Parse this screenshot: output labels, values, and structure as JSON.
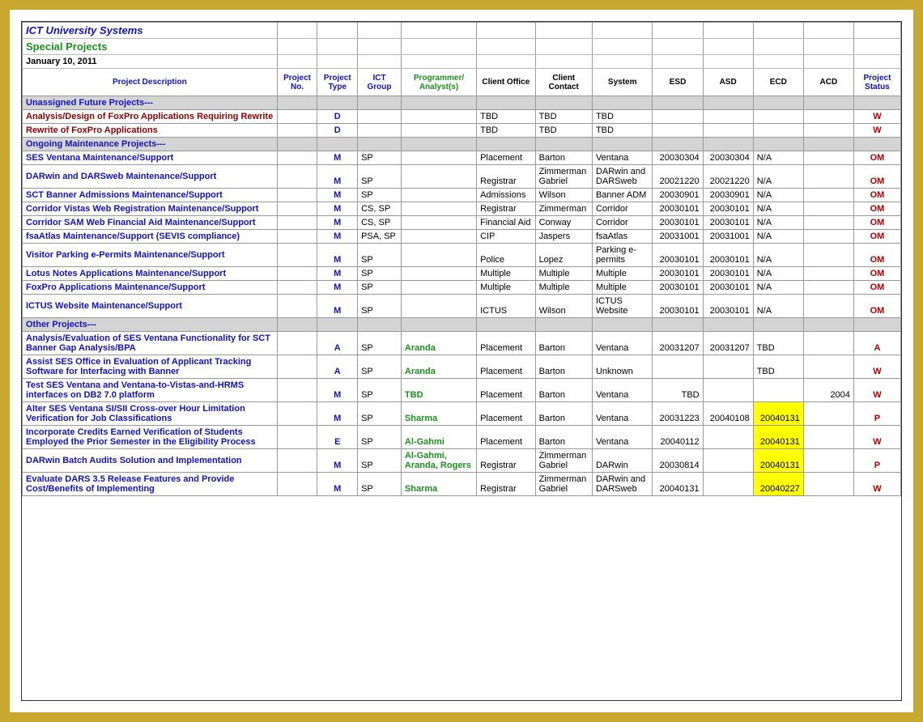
{
  "header": {
    "org": "ICT University Systems",
    "title": "Special Projects",
    "date": "January 10, 2011"
  },
  "columns": {
    "desc": "Project Description",
    "no": "Project No.",
    "type": "Project Type",
    "group": "ICT Group",
    "prog": "Programmer/ Analyst(s)",
    "office": "Client Office",
    "contact": "Client Contact",
    "system": "System",
    "esd": "ESD",
    "asd": "ASD",
    "ecd": "ECD",
    "acd": "ACD",
    "status": "Project Status"
  },
  "sections": [
    {
      "label": "Unassigned Future Projects---",
      "rows": [
        {
          "desc": "Analysis/Design of FoxPro Applications Requiring Rewrite",
          "descStyle": "darkred",
          "type": "D",
          "group": "",
          "prog": "",
          "office": "TBD",
          "contact": "TBD",
          "system": "TBD",
          "esd": "",
          "asd": "",
          "ecd": "",
          "ecdHL": false,
          "acd": "",
          "status": "W"
        },
        {
          "desc": "Rewrite of FoxPro Applications",
          "descStyle": "darkred",
          "type": "D",
          "group": "",
          "prog": "",
          "office": "TBD",
          "contact": "TBD",
          "system": "TBD",
          "esd": "",
          "asd": "",
          "ecd": "",
          "ecdHL": false,
          "acd": "",
          "status": "W"
        }
      ]
    },
    {
      "label": "Ongoing Maintenance Projects---",
      "rows": [
        {
          "desc": "SES Ventana Maintenance/Support",
          "descStyle": "",
          "type": "M",
          "group": "SP",
          "prog": "",
          "office": "Placement",
          "contact": "Barton",
          "system": "Ventana",
          "esd": "20030304",
          "asd": "20030304",
          "ecd": "N/A",
          "ecdHL": false,
          "acd": "",
          "status": "OM"
        },
        {
          "desc": "DARwin and DARSweb Maintenance/Support",
          "descStyle": "",
          "type": "M",
          "group": "SP",
          "prog": "",
          "office": "Registrar",
          "contact": "Zimmerman Gabriel",
          "system": "DARwin and DARSweb",
          "esd": "20021220",
          "asd": "20021220",
          "ecd": "N/A",
          "ecdHL": false,
          "acd": "",
          "status": "OM"
        },
        {
          "desc": "SCT Banner Admissions Maintenance/Support",
          "descStyle": "",
          "type": "M",
          "group": "SP",
          "prog": "",
          "office": "Admissions",
          "contact": "Wilson",
          "system": "Banner ADM",
          "esd": "20030901",
          "asd": "20030901",
          "ecd": "N/A",
          "ecdHL": false,
          "acd": "",
          "status": "OM"
        },
        {
          "desc": "Corridor Vistas Web Registration Maintenance/Support",
          "descStyle": "",
          "type": "M",
          "group": "CS, SP",
          "prog": "",
          "office": "Registrar",
          "contact": "Zimmerman",
          "system": "Corridor",
          "esd": "20030101",
          "asd": "20030101",
          "ecd": "N/A",
          "ecdHL": false,
          "acd": "",
          "status": "OM"
        },
        {
          "desc": "Corridor SAM Web Financial Aid Maintenance/Support",
          "descStyle": "",
          "type": "M",
          "group": "CS, SP",
          "prog": "",
          "office": "Financial Aid",
          "contact": "Conway",
          "system": "Corridor",
          "esd": "20030101",
          "asd": "20030101",
          "ecd": "N/A",
          "ecdHL": false,
          "acd": "",
          "status": "OM"
        },
        {
          "desc": "fsaAtlas Maintenance/Support (SEVIS compliance)",
          "descStyle": "",
          "type": "M",
          "group": "PSA, SP",
          "prog": "",
          "office": "CIP",
          "contact": "Jaspers",
          "system": "fsaAtlas",
          "esd": "20031001",
          "asd": "20031001",
          "ecd": "N/A",
          "ecdHL": false,
          "acd": "",
          "status": "OM"
        },
        {
          "desc": "Visitor Parking e-Permits Maintenance/Support",
          "descStyle": "",
          "type": "M",
          "group": "SP",
          "prog": "",
          "office": "Police",
          "contact": "Lopez",
          "system": "Parking e-permits",
          "esd": "20030101",
          "asd": "20030101",
          "ecd": "N/A",
          "ecdHL": false,
          "acd": "",
          "status": "OM"
        },
        {
          "desc": "Lotus Notes Applications Maintenance/Support",
          "descStyle": "",
          "type": "M",
          "group": "SP",
          "prog": "",
          "office": "Multiple",
          "contact": "Multiple",
          "system": "Multiple",
          "esd": "20030101",
          "asd": "20030101",
          "ecd": "N/A",
          "ecdHL": false,
          "acd": "",
          "status": "OM"
        },
        {
          "desc": "FoxPro Applications Maintenance/Support",
          "descStyle": "",
          "type": "M",
          "group": "SP",
          "prog": "",
          "office": "Multiple",
          "contact": "Multiple",
          "system": "Multiple",
          "esd": "20030101",
          "asd": "20030101",
          "ecd": "N/A",
          "ecdHL": false,
          "acd": "",
          "status": "OM"
        },
        {
          "desc": "ICTUS Website Maintenance/Support",
          "descStyle": "",
          "type": "M",
          "group": "SP",
          "prog": "",
          "office": "ICTUS",
          "contact": "Wilson",
          "system": "ICTUS Website",
          "esd": "20030101",
          "asd": "20030101",
          "ecd": "N/A",
          "ecdHL": false,
          "acd": "",
          "status": "OM"
        }
      ]
    },
    {
      "label": "Other Projects---",
      "rows": [
        {
          "desc": "Analysis/Evaluation of SES Ventana Functionality for SCT Banner Gap Analysis/BPA",
          "descStyle": "",
          "type": "A",
          "group": "SP",
          "prog": "Aranda",
          "office": "Placement",
          "contact": "Barton",
          "system": "Ventana",
          "esd": "20031207",
          "asd": "20031207",
          "ecd": "TBD",
          "ecdHL": false,
          "acd": "",
          "status": "A"
        },
        {
          "desc": "Assist SES Office in Evaluation of Applicant Tracking Software for Interfacing with Banner",
          "descStyle": "",
          "type": "A",
          "group": "SP",
          "prog": "Aranda",
          "office": "Placement",
          "contact": "Barton",
          "system": "Unknown",
          "esd": "",
          "asd": "",
          "ecd": "TBD",
          "ecdHL": false,
          "acd": "",
          "status": "W"
        },
        {
          "desc": "Test SES Ventana and Ventana-to-Vistas-and-HRMS interfaces on DB2 7.0 platform",
          "descStyle": "",
          "type": "M",
          "group": "SP",
          "prog": "TBD",
          "office": "Placement",
          "contact": "Barton",
          "system": "Ventana",
          "esd": "TBD",
          "asd": "",
          "ecd": "",
          "ecdHL": false,
          "acd": "2004",
          "status": "W"
        },
        {
          "desc": "Alter SES Ventana SI/SII Cross-over Hour Limitation Verification for Job Classifications",
          "descStyle": "",
          "type": "M",
          "group": "SP",
          "prog": "Sharma",
          "office": "Placement",
          "contact": "Barton",
          "system": "Ventana",
          "esd": "20031223",
          "asd": "20040108",
          "ecd": "20040131",
          "ecdHL": true,
          "acd": "",
          "status": "P"
        },
        {
          "desc": "Incorporate Credits Earned Verification of Students Employed the Prior Semester in the Eligibility Process",
          "descStyle": "",
          "type": "E",
          "group": "SP",
          "prog": "Al-Gahmi",
          "office": "Placement",
          "contact": "Barton",
          "system": "Ventana",
          "esd": "20040112",
          "asd": "",
          "ecd": "20040131",
          "ecdHL": true,
          "acd": "",
          "status": "W"
        },
        {
          "desc": "DARwin Batch Audits Solution and Implementation",
          "descStyle": "",
          "type": "M",
          "group": "SP",
          "prog": "Al-Gahmi, Aranda, Rogers",
          "office": "Registrar",
          "contact": "Zimmerman Gabriel",
          "system": "DARwin",
          "esd": "20030814",
          "asd": "",
          "ecd": "20040131",
          "ecdHL": true,
          "acd": "",
          "status": "P"
        },
        {
          "desc": "Evaluate DARS 3.5 Release Features and Provide Cost/Benefits of Implementing",
          "descStyle": "",
          "type": "M",
          "group": "SP",
          "prog": "Sharma",
          "office": "Registrar",
          "contact": "Zimmerman Gabriel",
          "system": "DARwin and DARSweb",
          "esd": "20040131",
          "asd": "",
          "ecd": "20040227",
          "ecdHL": true,
          "acd": "",
          "status": "W"
        }
      ]
    }
  ]
}
